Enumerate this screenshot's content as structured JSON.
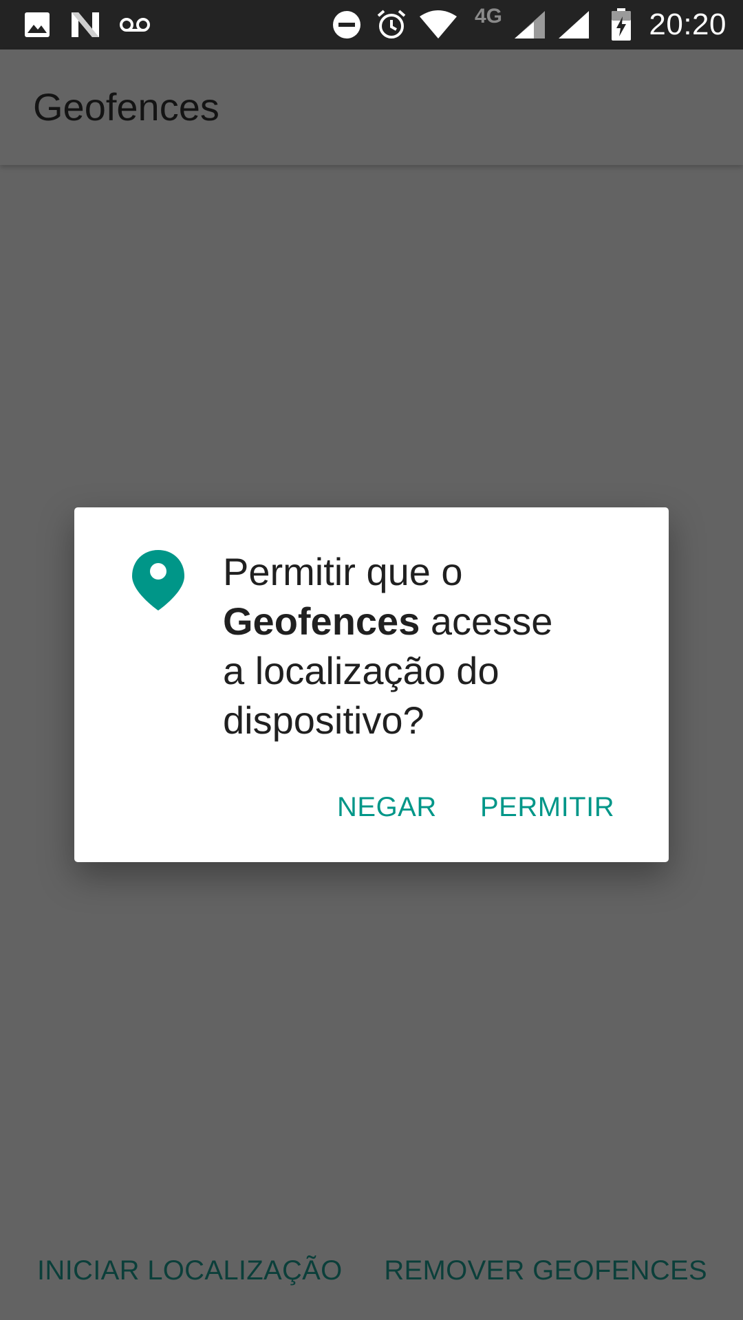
{
  "status_bar": {
    "time": "20:20",
    "network_label": "4G",
    "icons": [
      "image-icon",
      "n-logo-icon",
      "voicemail-icon",
      "do-not-disturb-icon",
      "alarm-icon",
      "wifi-icon",
      "signal-4g-icon",
      "signal-icon",
      "battery-charging-icon"
    ]
  },
  "app_bar": {
    "title": "Geofences"
  },
  "dialog": {
    "icon": "location-pin-icon",
    "message_prefix": "Permitir que o",
    "app_name": "Geofences",
    "message_after_app": "acesse",
    "message_line3": "a localização do",
    "message_line4": "dispositivo?",
    "deny_label": "NEGAR",
    "allow_label": "PERMITIR"
  },
  "bottom_buttons": {
    "start_label": "INICIAR LOCALIZAÇÃO",
    "remove_label": "REMOVER GEOFENCES"
  },
  "colors": {
    "accent": "#009688",
    "scrim_bg": "#636363",
    "status_bar_bg": "#232323"
  }
}
